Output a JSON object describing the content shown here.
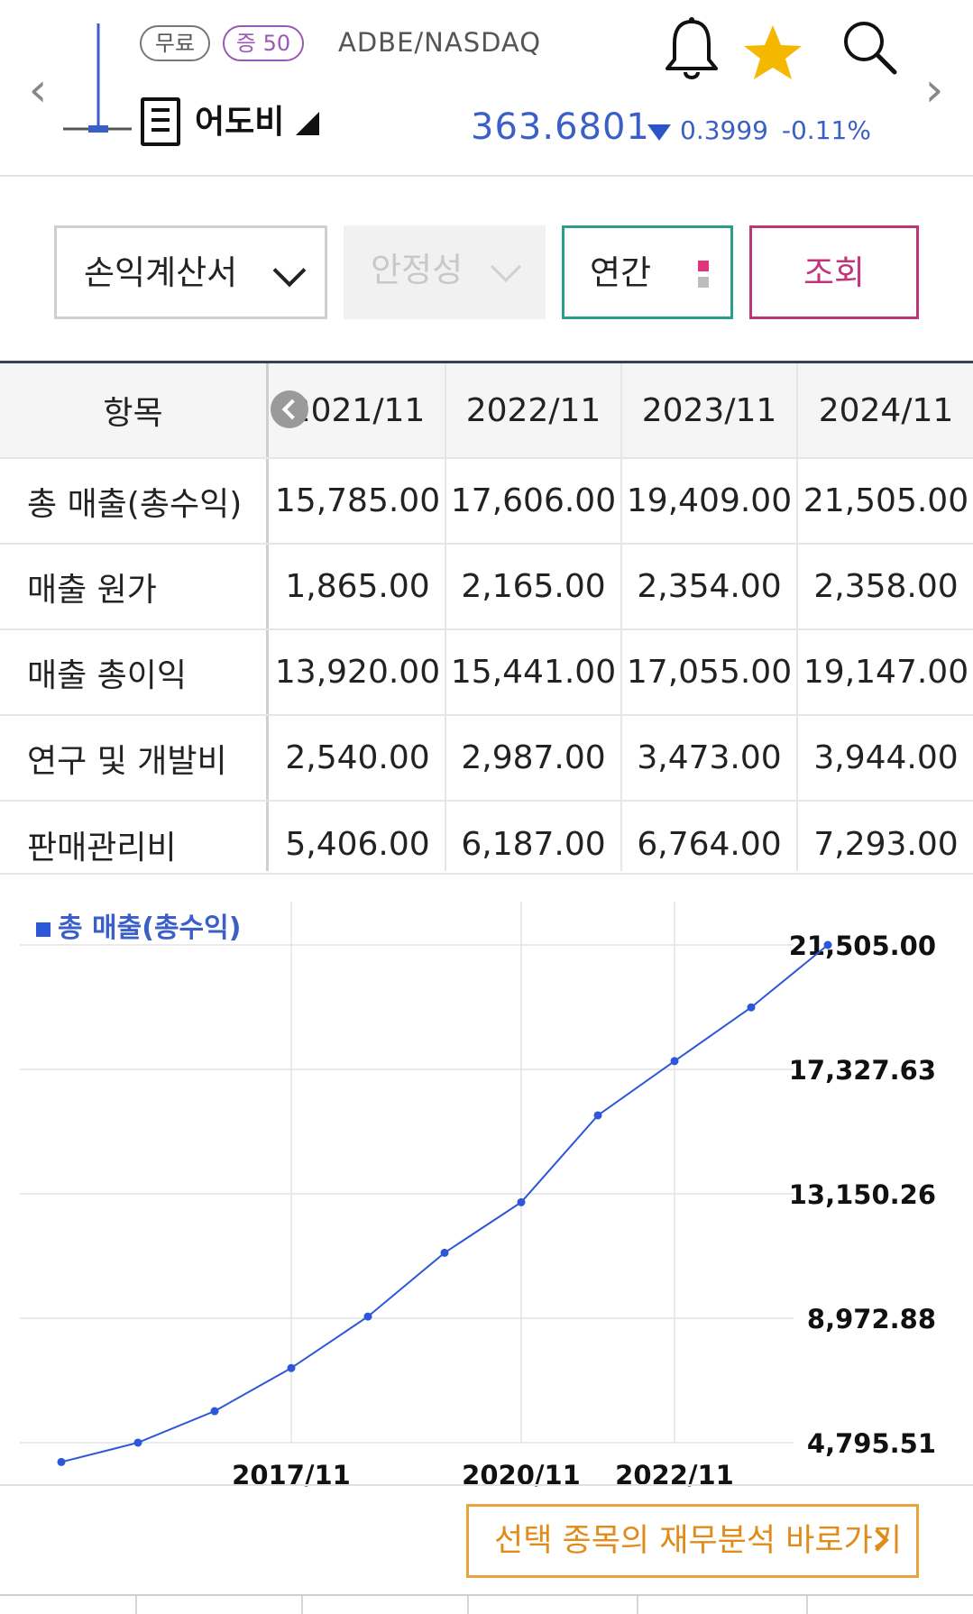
{
  "header": {
    "tags": {
      "free": "무료",
      "margin": "증 50"
    },
    "ticker": "ADBE/NASDAQ",
    "stock_name": "어도비",
    "price": "363.6801",
    "change": "0.3999 -0.11%",
    "icons": [
      "chevron-left-icon",
      "mini-chart-icon",
      "document-icon",
      "bell-icon",
      "star-icon",
      "search-icon",
      "chevron-right-icon"
    ],
    "colors": {
      "price": "#3a5fc8",
      "star": "#f5b800"
    }
  },
  "controls": {
    "report": "손익계산서",
    "metric": "안정성",
    "period": "연간",
    "query": "조회"
  },
  "table": {
    "header_label": "항목",
    "years": [
      "2021/11",
      "2022/11",
      "2023/11",
      "2024/11"
    ],
    "rows": [
      {
        "label": "총 매출(총수익)",
        "values": [
          "15,785.00",
          "17,606.00",
          "19,409.00",
          "21,505.00"
        ]
      },
      {
        "label": "매출 원가",
        "values": [
          "1,865.00",
          "2,165.00",
          "2,354.00",
          "2,358.00"
        ]
      },
      {
        "label": "매출 총이익",
        "values": [
          "13,920.00",
          "15,441.00",
          "17,055.00",
          "19,147.00"
        ]
      },
      {
        "label": "연구 및 개발비",
        "values": [
          "2,540.00",
          "2,987.00",
          "3,473.00",
          "3,944.00"
        ]
      },
      {
        "label": "판매관리비",
        "values": [
          "5,406.00",
          "6,187.00",
          "6,764.00",
          "7,293.00"
        ]
      }
    ]
  },
  "chart_data": {
    "type": "line",
    "legend": "총 매출(총수익)",
    "series": [
      {
        "name": "총 매출(총수익)",
        "x": [
          "2014/11",
          "2015/11",
          "2016/11",
          "2017/11",
          "2018/11",
          "2019/11",
          "2020/11",
          "2021/11",
          "2022/11",
          "2023/11",
          "2024/11"
        ],
        "values": [
          4147,
          4796,
          5854,
          7302,
          9030,
          11171,
          12868,
          15785,
          17606,
          19409,
          21505
        ]
      }
    ],
    "x_tick_labels": [
      "2017/11",
      "2020/11",
      "2022/11"
    ],
    "y_tick_labels": [
      "21,505.00",
      "17,327.63",
      "13,150.26",
      "8,972.88",
      "4,795.51"
    ],
    "ylim": [
      4795.51,
      21505
    ],
    "grid": true,
    "color": "#2b57d8"
  },
  "footer": {
    "goto_label": "선택 종목의 재무분석 바로가기"
  }
}
